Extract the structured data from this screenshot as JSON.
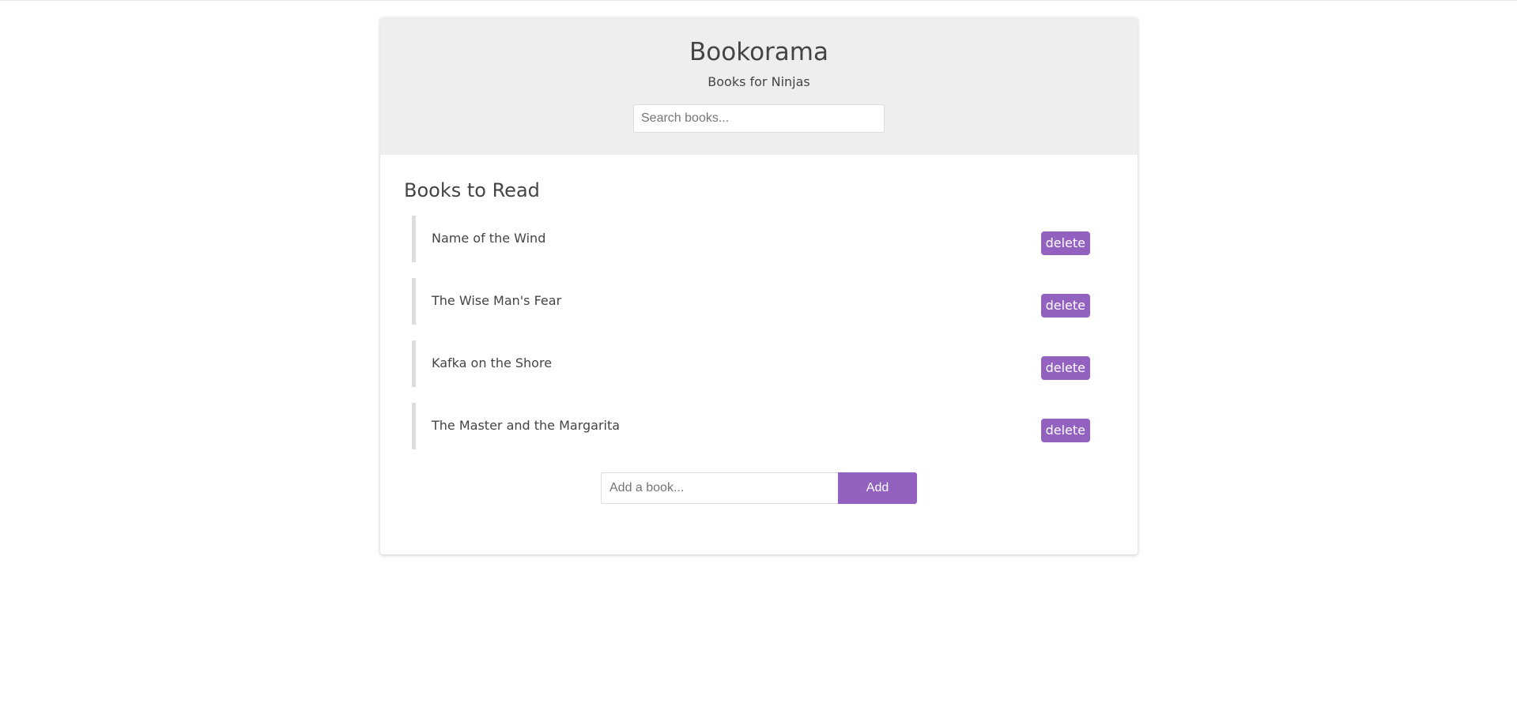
{
  "banner": {
    "title": "Bookorama",
    "subtitle": "Books for Ninjas",
    "search_placeholder": "Search books..."
  },
  "book_list": {
    "heading": "Books to Read",
    "delete_label": "delete",
    "items": [
      {
        "name": "Name of the Wind"
      },
      {
        "name": "The Wise Man's Fear"
      },
      {
        "name": "Kafka on the Shore"
      },
      {
        "name": "The Master and the Margarita"
      }
    ]
  },
  "add_form": {
    "placeholder": "Add a book...",
    "button_label": "Add"
  },
  "colors": {
    "accent": "#9361bf",
    "banner_bg": "#eeeeee",
    "item_border": "#dddddd",
    "text": "#444444"
  }
}
